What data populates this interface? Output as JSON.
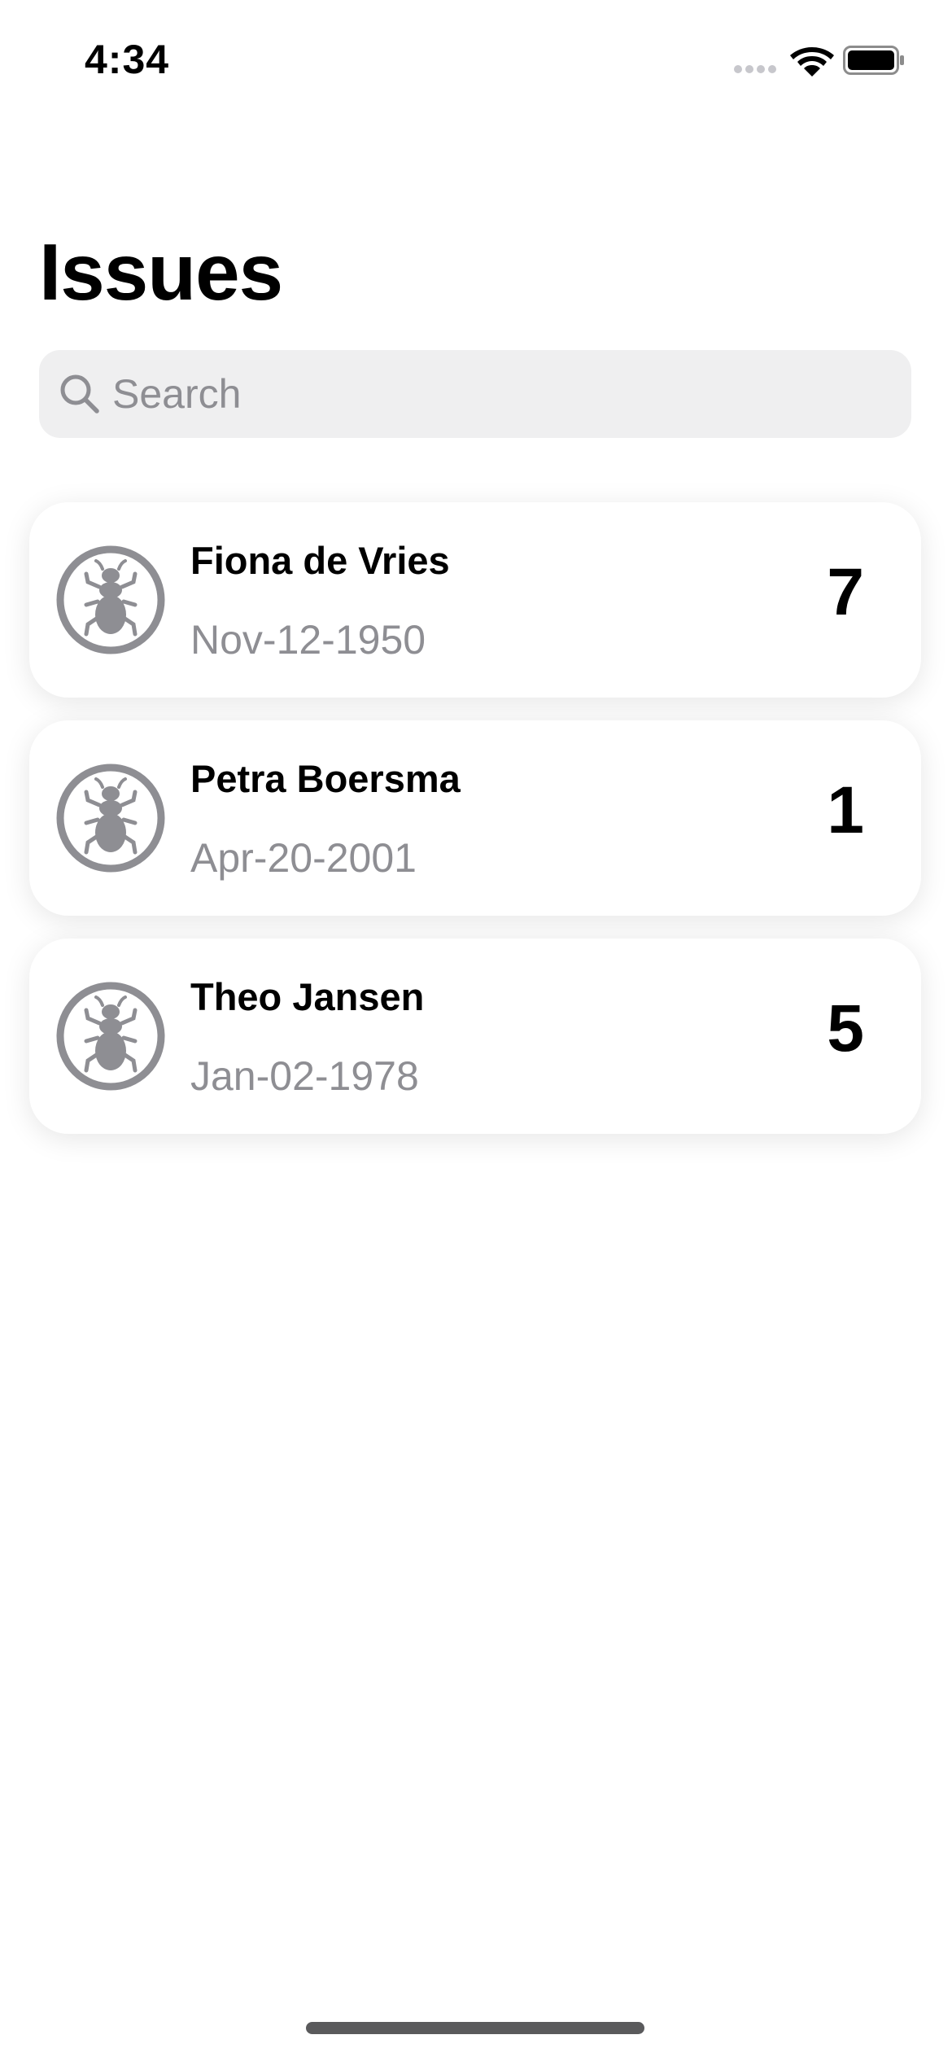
{
  "status_bar": {
    "time": "4:34",
    "icons": [
      "cellular-signal-icon",
      "wifi-icon",
      "battery-icon"
    ]
  },
  "header": {
    "title": "Issues"
  },
  "search": {
    "placeholder": "Search",
    "value": "",
    "icon": "magnifying-glass-icon"
  },
  "issues": [
    {
      "name": "Fiona de Vries",
      "date": "Nov-12-1950",
      "count": "7",
      "icon": "ant-icon"
    },
    {
      "name": "Petra Boersma",
      "date": "Apr-20-2001",
      "count": "1",
      "icon": "ant-icon"
    },
    {
      "name": "Theo Jansen",
      "date": "Jan-02-1978",
      "count": "5",
      "icon": "ant-icon"
    }
  ],
  "colors": {
    "secondary_text": "#8e8e93",
    "icon_gray": "#8e8e93",
    "search_background": "#efeff0",
    "card_background": "#ffffff"
  }
}
